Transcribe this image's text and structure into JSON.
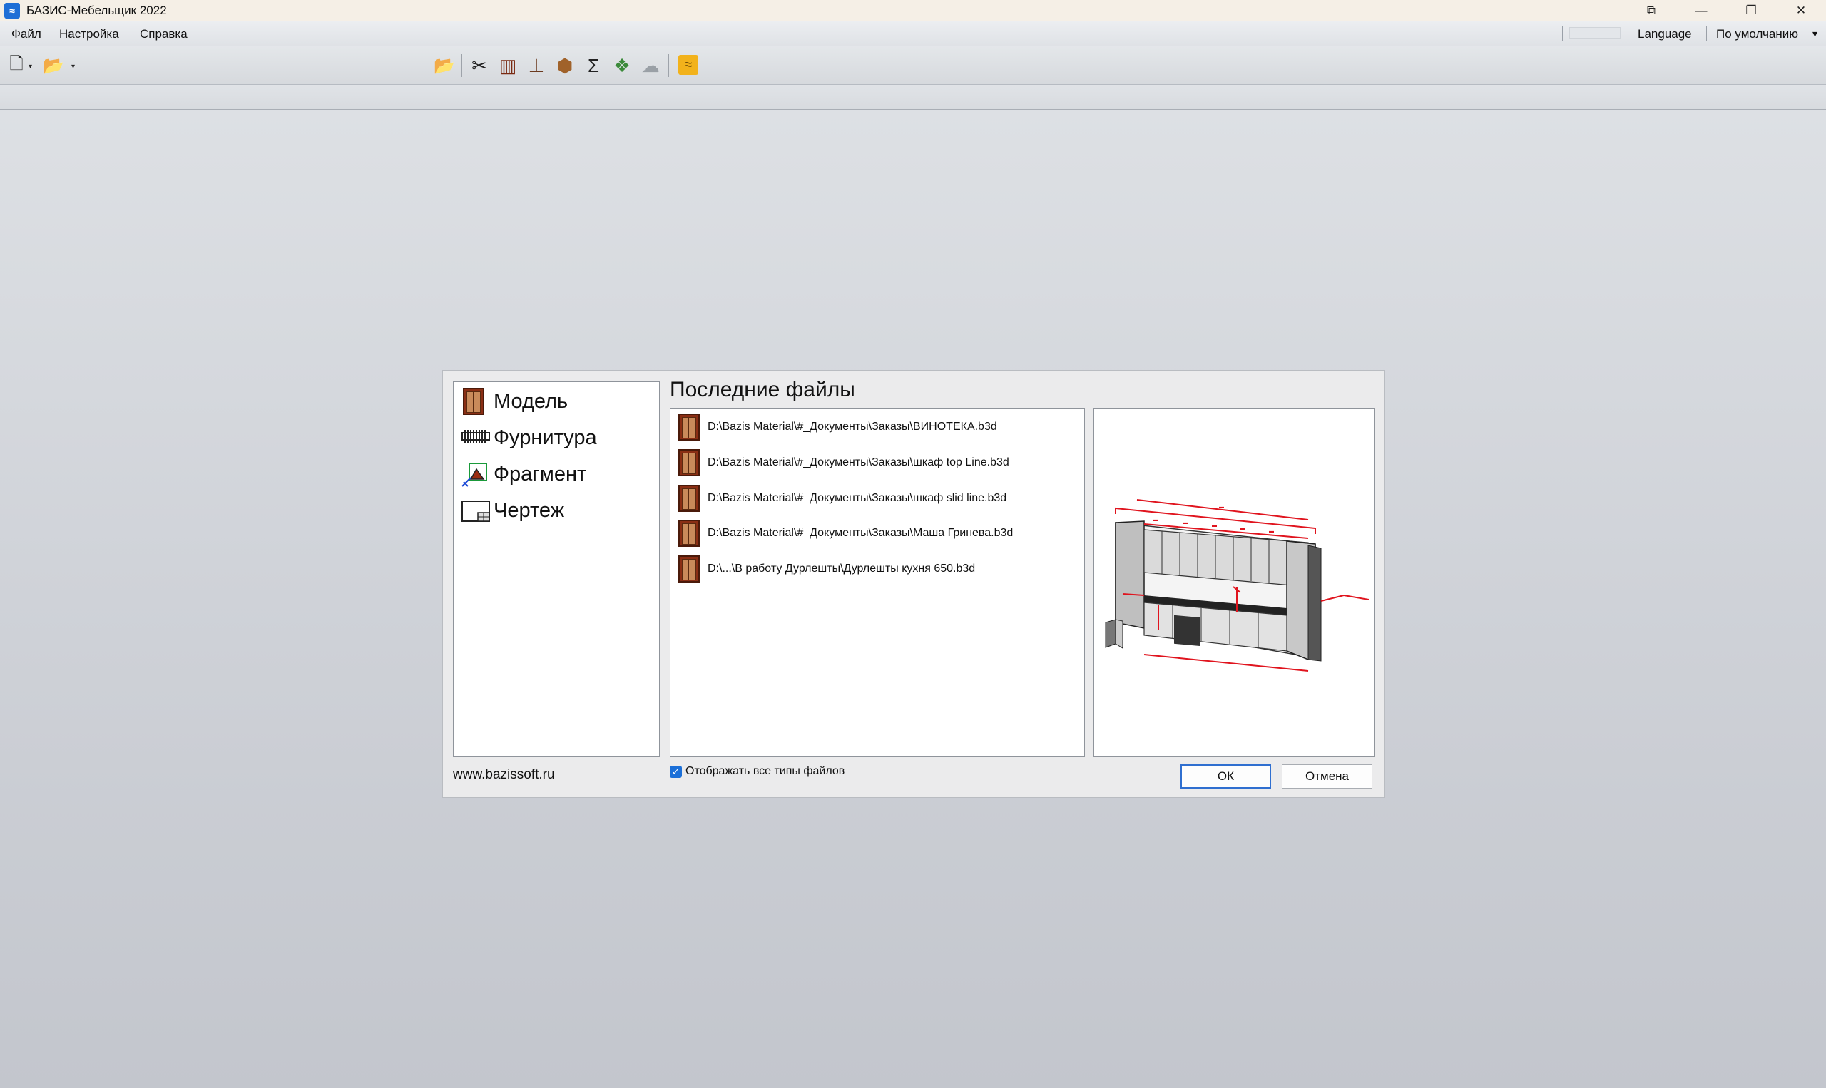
{
  "window": {
    "title": "БАЗИС-Мебельщик 2022",
    "app_icon_glyph": "≈",
    "controls": {
      "extra": "⧉",
      "minimize": "—",
      "maximize": "❐",
      "close": "✕"
    }
  },
  "menu": {
    "items": [
      "Файл",
      "Настройка",
      "Справка"
    ],
    "language_label": "Language",
    "profile_label": "По умолчанию",
    "profile_arrow": "▾"
  },
  "toolbar": {
    "new_icon": "🗋",
    "open_icon": "📂",
    "dropdown_arrow": "▾",
    "icons": [
      {
        "name": "open-folder-icon",
        "glyph": "📂"
      },
      {
        "name": "cutting-icon",
        "glyph": "✂"
      },
      {
        "name": "cabinet-icon",
        "glyph": "▥"
      },
      {
        "name": "edge-icon",
        "glyph": "⊥"
      },
      {
        "name": "package-icon",
        "glyph": "⬢"
      },
      {
        "name": "sum-icon",
        "glyph": "Σ"
      },
      {
        "name": "render-icon",
        "glyph": "❖"
      },
      {
        "name": "cloud-icon",
        "glyph": "☁"
      },
      {
        "name": "bazis-icon",
        "glyph": "≈"
      }
    ]
  },
  "dialog": {
    "types": [
      {
        "label": "Модель",
        "icon": "model-icon"
      },
      {
        "label": "Фурнитура",
        "icon": "fittings-icon"
      },
      {
        "label": "Фрагмент",
        "icon": "fragment-icon"
      },
      {
        "label": "Чертеж",
        "icon": "drawing-icon"
      }
    ],
    "recent_title": "Последние файлы",
    "recent_files": [
      "D:\\Bazis Material\\#_Документы\\Заказы\\ВИНОТЕКА.b3d",
      "D:\\Bazis Material\\#_Документы\\Заказы\\шкаф top Line.b3d",
      "D:\\Bazis Material\\#_Документы\\Заказы\\шкаф slid line.b3d",
      "D:\\Bazis Material\\#_Документы\\Заказы\\Маша Гринева.b3d",
      "D:\\...\\В работу Дурлешты\\Дурлешты кухня 650.b3d"
    ],
    "site": "www.bazissoft.ru",
    "show_all_types_label": "Отображать все типы файлов",
    "show_all_types_checked": true,
    "checkmark": "✓",
    "ok_label": "ОК",
    "cancel_label": "Отмена"
  },
  "colors": {
    "accent": "#1b6fd8",
    "cabinet_wood": "#8a2e14",
    "dimension_red": "#e0141e"
  }
}
